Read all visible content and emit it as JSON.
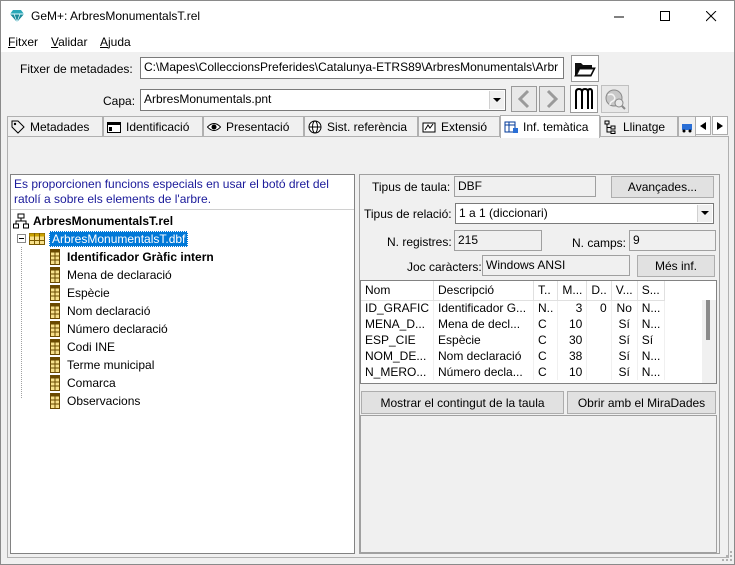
{
  "window": {
    "title": "GeM+: ArbresMonumentalsT.rel",
    "minimize": "—",
    "maximize": "☐",
    "close": "✕"
  },
  "menu": [
    {
      "label": "Fitxer",
      "accel": "F",
      "rest": "itxer"
    },
    {
      "label": "Validar",
      "accel": "V",
      "rest": "alidar"
    },
    {
      "label": "Ajuda",
      "accel": "A",
      "rest": "juda"
    }
  ],
  "form": {
    "fitxer_label": "Fitxer de metadades:",
    "fitxer_value": "C:\\Mapes\\ColleccionsPreferides\\Catalunya-ETRS89\\ArbresMonumentals\\Arbr",
    "capa_label": "Capa:",
    "capa_value": "ArbresMonumentals.pnt"
  },
  "tabs": [
    {
      "label": "Metadades",
      "icon": "tag-icon"
    },
    {
      "label": "Identificació",
      "icon": "id-card-icon"
    },
    {
      "label": "Presentació",
      "icon": "eye-icon"
    },
    {
      "label": "Sist. referència",
      "icon": "globe-icon"
    },
    {
      "label": "Extensió",
      "icon": "extent-icon"
    },
    {
      "label": "Inf. temàtica",
      "icon": "table-info-icon",
      "active": true
    },
    {
      "label": "Llinatge",
      "icon": "lineage-icon"
    }
  ],
  "tree": {
    "hint": "Es proporcionen funcions especials en usar el botó dret del ratolí a sobre els elements de l'arbre.",
    "root": "ArbresMonumentalsT.rel",
    "table": "ArbresMonumentalsT.dbf",
    "fields": [
      {
        "label": "Identificador Gràfic intern",
        "bold": true
      },
      {
        "label": "Mena de declaració"
      },
      {
        "label": "Espècie"
      },
      {
        "label": "Nom declaració"
      },
      {
        "label": "Número declaració"
      },
      {
        "label": "Codi INE"
      },
      {
        "label": "Terme municipal"
      },
      {
        "label": "Comarca"
      },
      {
        "label": "Observacions"
      }
    ]
  },
  "info": {
    "tipus_taula_label": "Tipus de taula:",
    "tipus_taula_value": "DBF",
    "avancades": "Avançades...",
    "tipus_relacio_label": "Tipus de relació:",
    "tipus_relacio_value": "1 a 1 (diccionari)",
    "n_registres_label": "N. registres:",
    "n_registres_value": "215",
    "n_camps_label": "N. camps:",
    "n_camps_value": "9",
    "joc_label": "Joc caràcters:",
    "joc_value": "Windows ANSI",
    "mes_inf": "Més inf."
  },
  "grid": {
    "headers": [
      "Nom",
      "Descripció",
      "T..",
      "M...",
      "D..",
      "V...",
      "S..."
    ],
    "rows": [
      [
        "ID_GRAFIC",
        "Identificador G...",
        "N..",
        "3",
        "0",
        "No",
        "N..."
      ],
      [
        "MENA_D...",
        "Mena de decl...",
        "C",
        "10",
        "",
        "Sí",
        "N..."
      ],
      [
        "ESP_CIE",
        "Espècie",
        "C",
        "30",
        "",
        "Sí",
        "Sí"
      ],
      [
        "NOM_DE...",
        "Nom declaració",
        "C",
        "38",
        "",
        "Sí",
        "N..."
      ],
      [
        "N_MERO...",
        "Número decla...",
        "C",
        "10",
        "",
        "Sí",
        "N..."
      ]
    ]
  },
  "buttons": {
    "mostrar": "Mostrar el contingut de la taula",
    "obrir": "Obrir amb el MiraDades"
  }
}
